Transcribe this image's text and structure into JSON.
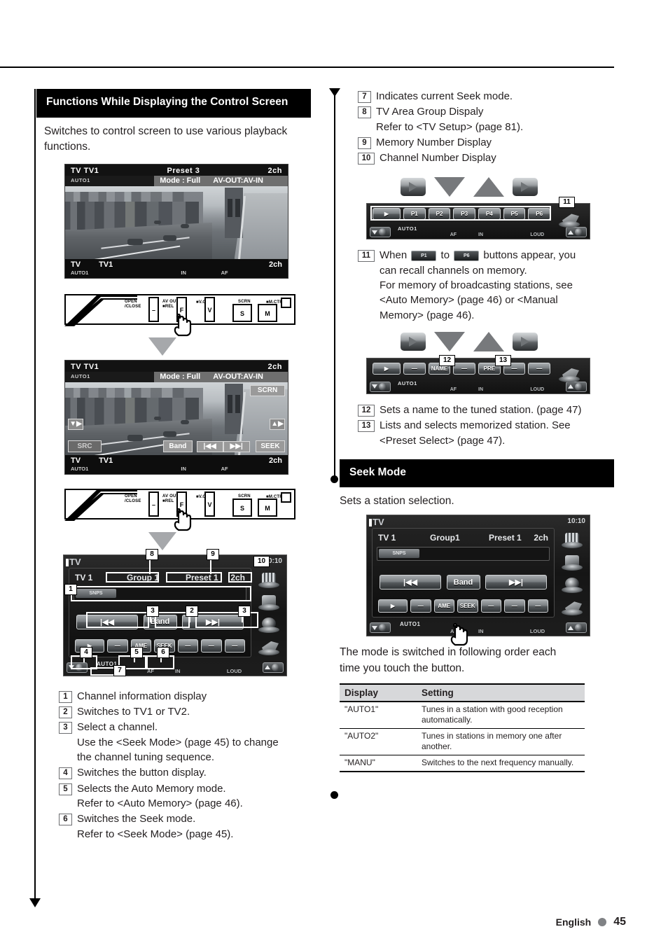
{
  "page": {
    "language": "English",
    "number": "45"
  },
  "left": {
    "section_title": "Functions While Displaying the Control Screen",
    "intro": "Switches to control screen to use various playback functions.",
    "screen1": {
      "hdr_left": "TV  TV1",
      "hdr_mid": "Preset  3",
      "hdr_right": "2ch",
      "auto": "AUTO1",
      "mode": "Mode : Full",
      "avout": "AV-OUT:AV-IN",
      "foot_left": "TV",
      "foot_left2": "TV1",
      "foot_right": "2ch",
      "foot_auto": "AUTO1",
      "foot_in": "IN",
      "foot_af": "AF"
    },
    "screen2": {
      "hdr_left": "TV  TV1",
      "hdr_right": "2ch",
      "auto": "AUTO1",
      "mode": "Mode : Full",
      "avout": "AV-OUT:AV-IN",
      "scrn": "SCRN",
      "src": "SRC",
      "band": "Band",
      "prev": "|◀◀",
      "next": "▶▶|",
      "seek": "SEEK",
      "foot_left": "TV",
      "foot_left2": "TV1",
      "foot_right": "2ch",
      "foot_auto": "AUTO1",
      "foot_in": "IN",
      "foot_af": "AF"
    },
    "faceplate": {
      "open_close": "OPEN\n/CLOSE",
      "av_out": "AV OUT",
      "rel": "REL",
      "v_off": "V.OFF",
      "scrn": "SCRN",
      "m_ctrl": "M.CTRL",
      "key_minus": "–",
      "key_f": "F",
      "key_v": "V",
      "key_s": "S",
      "key_m": "M"
    },
    "control_screen": {
      "source": "TV",
      "clock": "10:10",
      "band": "TV 1",
      "group": "Group 1",
      "preset": "Preset 1",
      "channel": "2ch",
      "snps": "SNPS",
      "prev": "|◀◀",
      "next": "▶▶|",
      "band_btn": "Band",
      "ame": "AME",
      "seek": "SEEK",
      "auto_mode": "AUTO1",
      "af": "AF",
      "in": "IN",
      "loud": "LOUD"
    },
    "callouts": [
      {
        "n": "1",
        "text": "Channel information display",
        "sub": []
      },
      {
        "n": "2",
        "text": "Switches to TV1 or TV2.",
        "sub": []
      },
      {
        "n": "3",
        "text": "Select a channel.",
        "sub": [
          "Use the <Seek Mode> (page 45) to change",
          "the channel tuning sequence."
        ]
      },
      {
        "n": "4",
        "text": "Switches the button display.",
        "sub": []
      },
      {
        "n": "5",
        "text": "Selects the Auto Memory mode.",
        "sub": [
          "Refer to <Auto Memory> (page 46)."
        ]
      },
      {
        "n": "6",
        "text": "Switches the Seek mode.",
        "sub": [
          "Refer to <Seek Mode> (page 45)."
        ]
      }
    ]
  },
  "right": {
    "callouts_top": [
      {
        "n": "7",
        "text": "Indicates current Seek mode.",
        "sub": []
      },
      {
        "n": "8",
        "text": "TV Area Group Dispaly",
        "sub": [
          "Refer to <TV Setup> (page 81)."
        ]
      },
      {
        "n": "9",
        "text": "Memory Number Display",
        "sub": []
      },
      {
        "n": "10",
        "text": "Channel Number Display",
        "sub": []
      }
    ],
    "preset_strip": {
      "presets": [
        "P1",
        "P2",
        "P3",
        "P4",
        "P5",
        "P6"
      ],
      "auto_mode": "AUTO1",
      "af": "AF",
      "in": "IN",
      "loud": "LOUD",
      "callout": "11"
    },
    "callout11": {
      "n": "11",
      "part1": "When",
      "chip1": "P1",
      "part2": "to",
      "chip2": "P6",
      "part3": "buttons appear, you",
      "line2": "can recall channels on memory.",
      "line3": "For memory of broadcasting stations, see",
      "line4": "<Auto Memory> (page 46) or <Manual",
      "line5": "Memory> (page 46)."
    },
    "name_strip": {
      "name_btn": "NAME",
      "preset_btn": "PRE",
      "auto_mode": "AUTO1",
      "af": "AF",
      "in": "IN",
      "loud": "LOUD",
      "callout_a": "12",
      "callout_b": "13"
    },
    "callouts_bottom": [
      {
        "n": "12",
        "text": "Sets a name to the tuned station. (page 47)",
        "sub": []
      },
      {
        "n": "13",
        "text": "Lists and selects memorized station. See",
        "sub": [
          "<Preset Select> (page 47)."
        ]
      }
    ],
    "seek_section": {
      "title": "Seek Mode",
      "intro": "Sets a station selection.",
      "screen": {
        "source": "TV",
        "clock": "10:10",
        "band": "TV 1",
        "group": "Group1",
        "preset": "Preset 1",
        "channel": "2ch",
        "snps": "SNPS",
        "prev": "|◀◀",
        "next": "▶▶|",
        "band_btn": "Band",
        "ame": "AME",
        "seek": "SEEK",
        "auto_mode": "AUTO1",
        "af": "AF",
        "in": "IN",
        "loud": "LOUD"
      },
      "note_line1": "The mode is switched in following order each",
      "note_line2": "time you touch the button.",
      "table": {
        "headers": [
          "Display",
          "Setting"
        ],
        "rows": [
          [
            "\"AUTO1\"",
            "Tunes in a station with good reception automatically."
          ],
          [
            "\"AUTO2\"",
            "Tunes in stations in memory one after another."
          ],
          [
            "\"MANU\"",
            "Switches to the next frequency manually."
          ]
        ]
      }
    }
  }
}
